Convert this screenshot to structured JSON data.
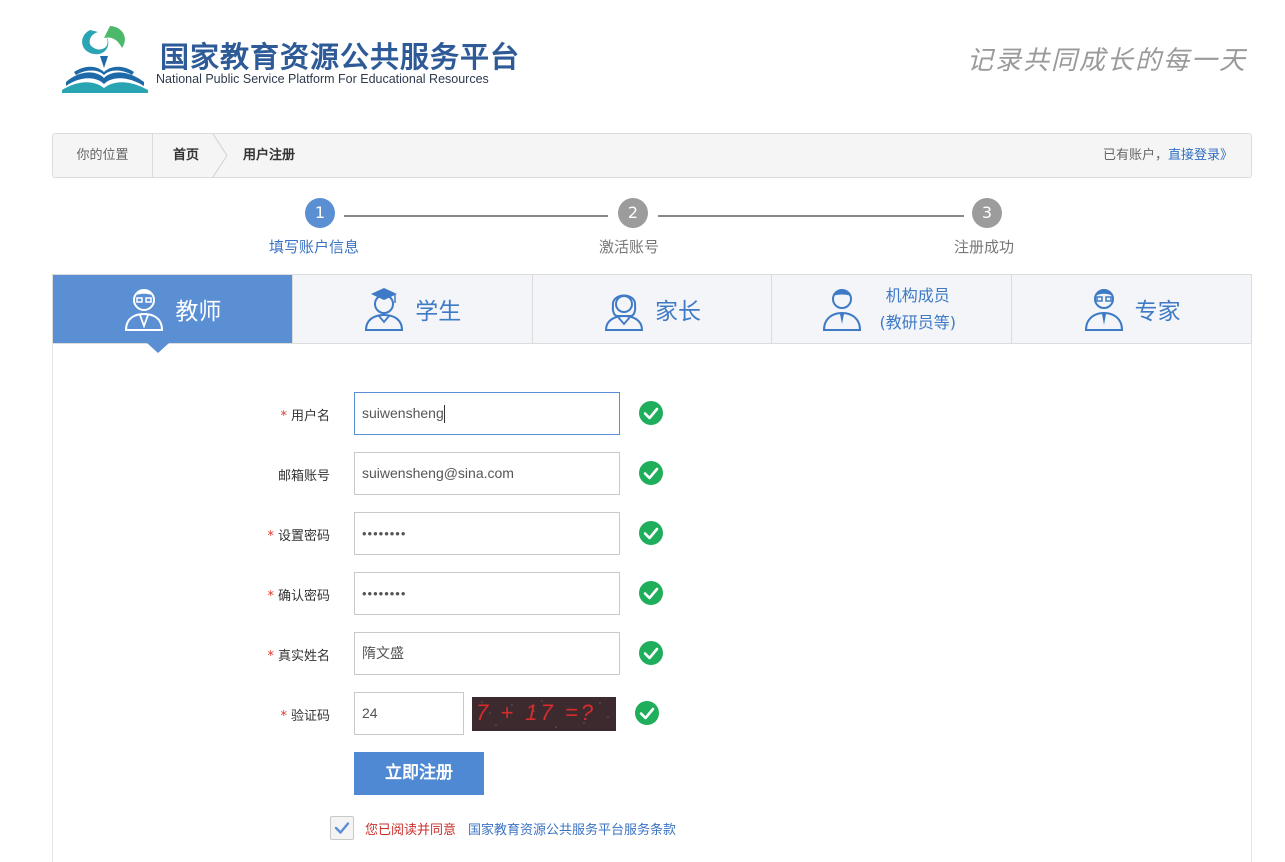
{
  "header": {
    "brand_cn": "国家教育资源公共服务平台",
    "brand_en": "National Public  Service Platform For Educational Resources",
    "slogan": "记录共同成长的每一天"
  },
  "breadcrumb": {
    "you_are_here": "你的位置",
    "home": "首页",
    "current": "用户注册",
    "have_account": "已有账户，",
    "login_link": "直接登录》"
  },
  "steps": [
    {
      "num": "1",
      "label": "填写账户信息",
      "active": true
    },
    {
      "num": "2",
      "label": "激活账号",
      "active": false
    },
    {
      "num": "3",
      "label": "注册成功",
      "active": false
    }
  ],
  "roles": {
    "teacher": "教师",
    "student": "学生",
    "parent": "家长",
    "org_line1": "机构成员",
    "org_line2": "(教研员等)",
    "expert": "专家",
    "selected": "教师"
  },
  "form": {
    "username": {
      "label": "用户名",
      "value": "suiwensheng",
      "required": true
    },
    "email": {
      "label": "邮箱账号",
      "value": "suiwensheng@sina.com",
      "required": false
    },
    "password": {
      "label": "设置密码",
      "value": "••••••••",
      "required": true
    },
    "confirm": {
      "label": "确认密码",
      "value": "••••••••",
      "required": true
    },
    "realname": {
      "label": "真实姓名",
      "value": "隋文盛",
      "required": true
    },
    "captcha": {
      "label": "验证码",
      "value": "24",
      "required": true,
      "image_text": "7 + 17 =?"
    },
    "required_mark": "*"
  },
  "submit_label": "立即注册",
  "agreement": {
    "checked": true,
    "text": "您已阅读并同意",
    "link": "国家教育资源公共服务平台服务条款"
  },
  "colors": {
    "primary": "#5b8fd4",
    "success": "#1fae5b",
    "required": "#e0352b",
    "link": "#3b73c4"
  }
}
